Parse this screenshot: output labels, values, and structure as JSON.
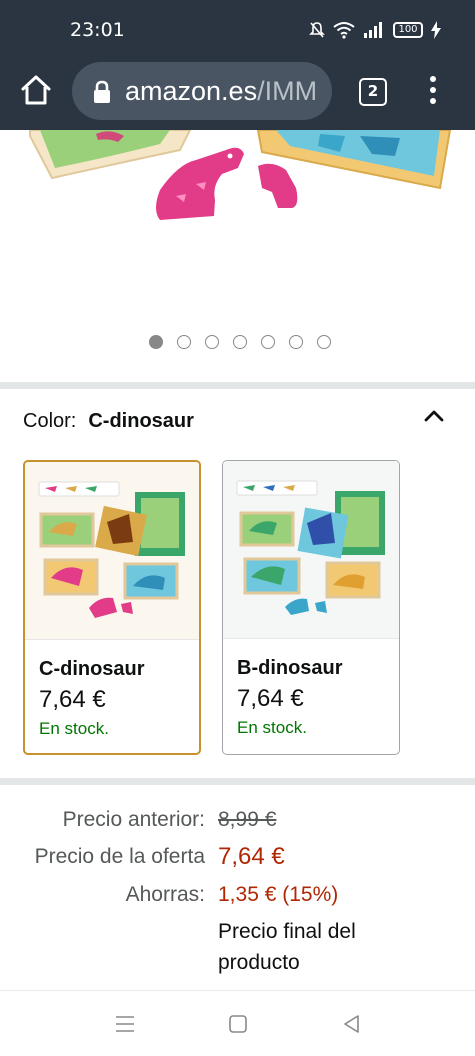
{
  "status_bar": {
    "time": "23:01",
    "battery": "100",
    "icons": [
      "mute-icon",
      "wifi-icon",
      "signal-icon",
      "battery-icon",
      "charging-icon"
    ]
  },
  "browser": {
    "url_host": "amazon.es",
    "url_path": "/IMM",
    "tab_count": "2"
  },
  "carousel": {
    "total": 7,
    "active_index": 0
  },
  "color_selector": {
    "label": "Color:",
    "selected_value": "C-dinosaur",
    "options": [
      {
        "name": "C-dinosaur",
        "price": "7,64 €",
        "stock": "En stock.",
        "selected": true
      },
      {
        "name": "B-dinosaur",
        "price": "7,64 €",
        "stock": "En stock.",
        "selected": false
      }
    ]
  },
  "pricing": {
    "prev_label": "Precio anterior:",
    "prev_value": "8,99 €",
    "deal_label": "Precio de la oferta",
    "deal_value": "7,64 €",
    "save_label": "Ahorras:",
    "save_value": "1,35 € (15%)",
    "final_line1": "Precio final del",
    "final_line2": "producto"
  },
  "colors": {
    "chrome_bg": "#2b3542",
    "selected_border": "#c7912d",
    "price_red": "#b12704",
    "stock_green": "#007600"
  }
}
